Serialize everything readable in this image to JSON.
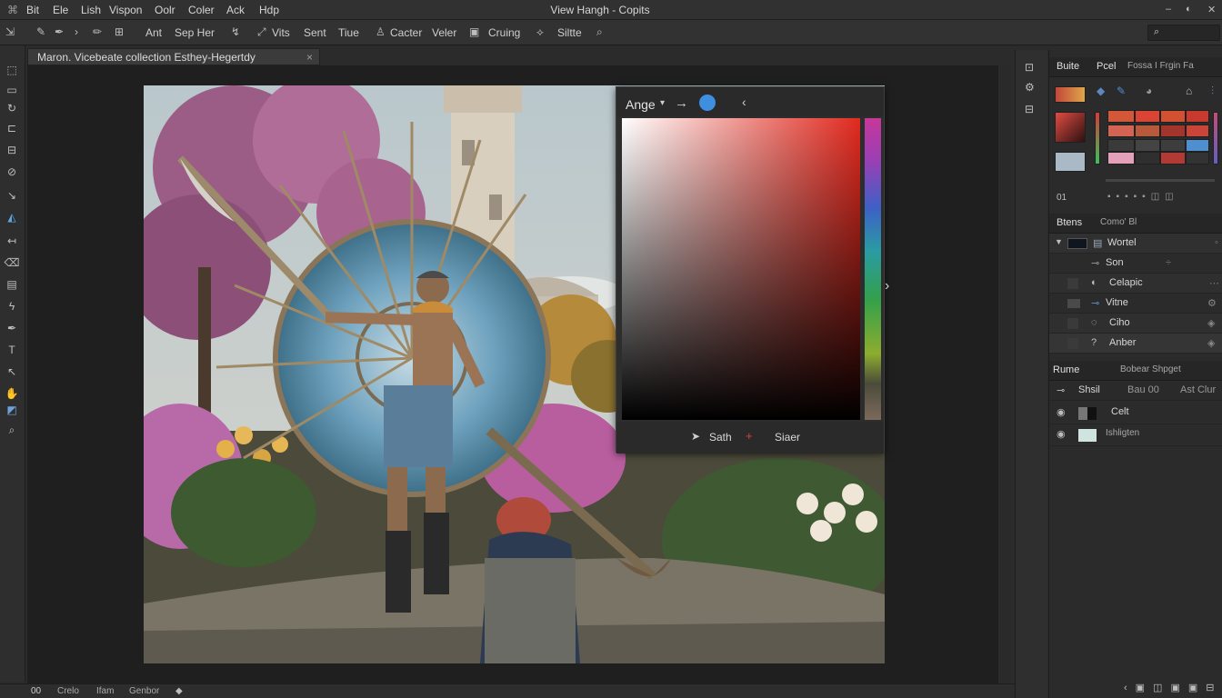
{
  "app": {
    "title": "View Hangh - Copits"
  },
  "menu": [
    "Bit",
    "Ele",
    "Lish",
    "Vispon",
    "Oolr",
    "Coler",
    "Ack",
    "Hdp"
  ],
  "window_controls": [
    "–",
    "◐",
    "✕"
  ],
  "options_bar": {
    "items": [
      "Ant",
      "Sep Her",
      "Vits",
      "Sent",
      "Tiue",
      "Cacter",
      "Veler",
      "Cruing",
      "Siltte"
    ]
  },
  "document": {
    "tab_title": "Maron. Vicebeate collection Esthey-Hegertdy"
  },
  "color_picker": {
    "mode_label": "Ange",
    "footer_left": "Sath",
    "footer_right": "Siaer",
    "colors": {
      "field_hue": "#e12a1f"
    }
  },
  "panels": {
    "swatches_tabs": [
      "Buite",
      "Pcel",
      "Fossa I Frgin Fa"
    ],
    "swatch_footer_label": "01",
    "layers_tabs": [
      "Btens",
      "Como' Bl"
    ],
    "layers": [
      {
        "name": "Wortel",
        "group": true
      },
      {
        "name": "Son"
      },
      {
        "name": "Celapic"
      },
      {
        "name": "Vitne"
      },
      {
        "name": "Ciho"
      },
      {
        "name": "Anber"
      }
    ],
    "props_tabs": [
      "Rume",
      "Bobear Shpget"
    ],
    "props_subtabs": [
      "Shsil",
      "Bau 00",
      "Ast Clur"
    ],
    "props_rows": [
      {
        "name": "Celt"
      },
      {
        "name": "Ishligten"
      }
    ]
  },
  "status_bar": {
    "zoom": "00",
    "items": [
      "Crelo",
      "Ifam",
      "Genbor"
    ]
  }
}
